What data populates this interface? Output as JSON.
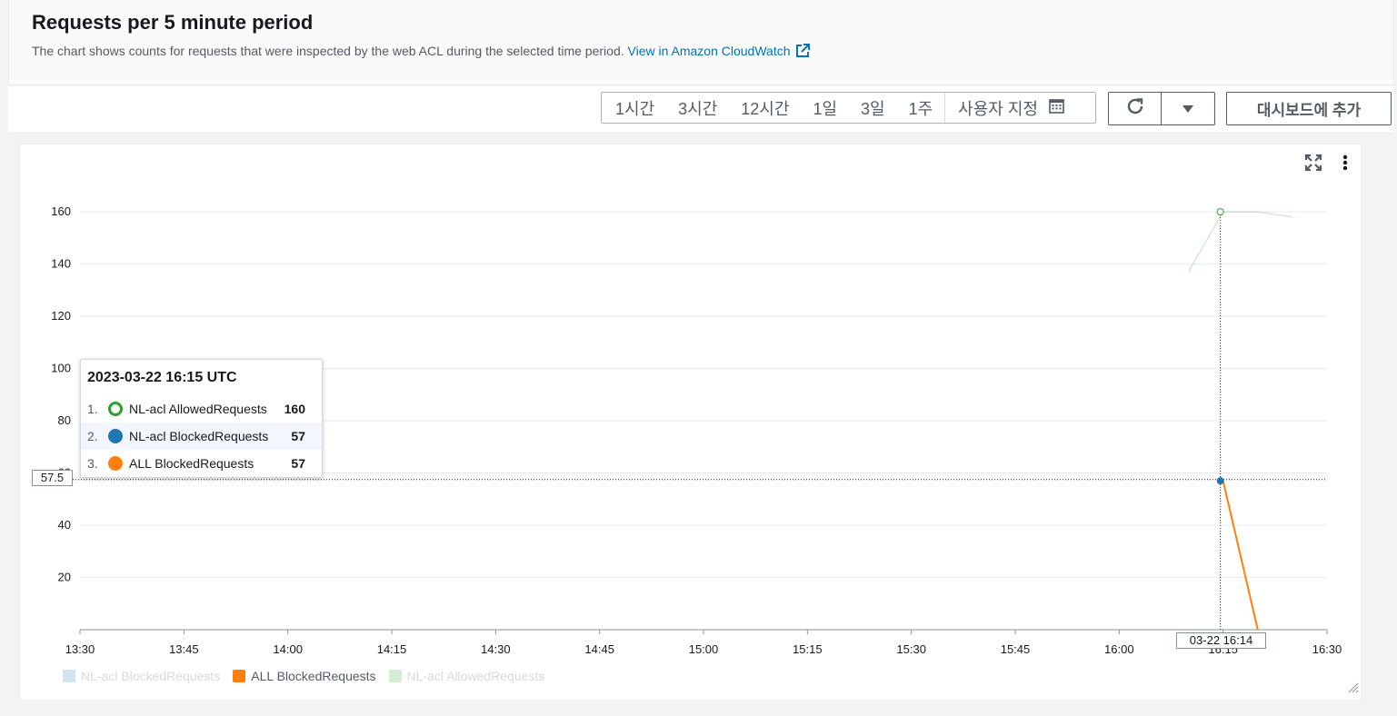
{
  "header": {
    "title": "Requests per 5 minute period",
    "description": "The chart shows counts for requests that were inspected by the web ACL during the selected time period.",
    "cloudwatch_link": "View in Amazon CloudWatch"
  },
  "toolbar": {
    "ranges": [
      "1시간",
      "3시간",
      "12시간",
      "1일",
      "3일",
      "1주"
    ],
    "custom_range": "사용자 지정",
    "add_to_dashboard": "대시보드에 추가"
  },
  "tooltip": {
    "time": "2023-03-22 16:15 UTC",
    "rows": [
      {
        "index": "1.",
        "label": "NL-acl AllowedRequests",
        "value": "160",
        "color": "#2ca02c",
        "hollow": true
      },
      {
        "index": "2.",
        "label": "NL-acl BlockedRequests",
        "value": "57",
        "color": "#1f77b4",
        "hollow": false
      },
      {
        "index": "3.",
        "label": "ALL BlockedRequests",
        "value": "57",
        "color": "#ff7f0e",
        "hollow": false
      }
    ]
  },
  "crosshair": {
    "y_value_label": "57.5",
    "x_value_label": "03-22 16:14"
  },
  "legend": [
    {
      "label": "NL-acl BlockedRequests",
      "color": "#1f77b4",
      "faded": true
    },
    {
      "label": "ALL BlockedRequests",
      "color": "#ff7f0e",
      "faded": false
    },
    {
      "label": "NL-acl AllowedRequests",
      "color": "#2ca02c",
      "faded": true
    }
  ],
  "chart_data": {
    "type": "line",
    "title": "",
    "xlabel": "",
    "ylabel": "",
    "x_ticks": [
      "13:30",
      "13:45",
      "14:00",
      "14:15",
      "14:30",
      "14:45",
      "15:00",
      "15:15",
      "15:30",
      "15:45",
      "16:00",
      "16:15",
      "16:30"
    ],
    "y_ticks": [
      20,
      40,
      60,
      80,
      100,
      120,
      140,
      160
    ],
    "xlim": [
      "13:30",
      "16:30"
    ],
    "ylim": [
      0,
      175
    ],
    "grid": true,
    "legend_position": "bottom-left",
    "series": [
      {
        "name": "NL-acl BlockedRequests",
        "color": "#1f77b4",
        "faded": true,
        "points": [
          {
            "x": "16:15",
            "y": 57
          }
        ]
      },
      {
        "name": "ALL BlockedRequests",
        "color": "#ff7f0e",
        "faded": false,
        "points": [
          {
            "x": "16:15",
            "y": 57
          },
          {
            "x": "16:20",
            "y": 0
          }
        ]
      },
      {
        "name": "NL-acl AllowedRequests",
        "color": "#2ca02c",
        "faded": true,
        "points": [
          {
            "x": "16:10",
            "y": 137
          },
          {
            "x": "16:15",
            "y": 160
          },
          {
            "x": "16:20",
            "y": 160
          },
          {
            "x": "16:25",
            "y": 158
          }
        ]
      }
    ]
  }
}
